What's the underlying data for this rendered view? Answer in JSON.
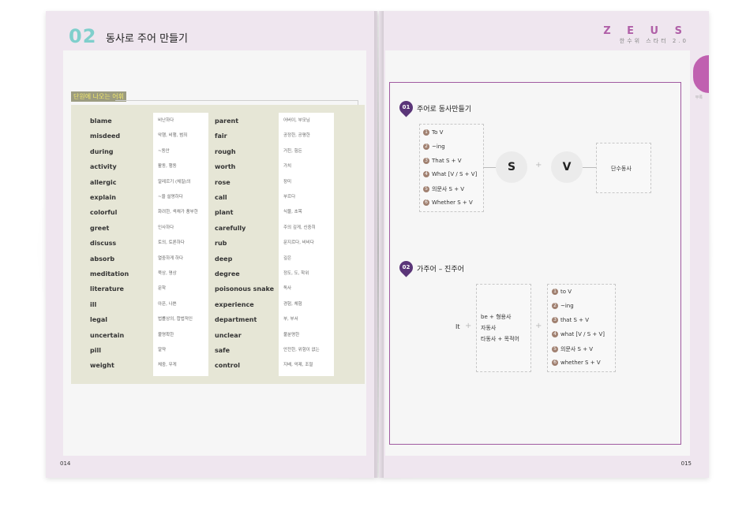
{
  "left_page": {
    "chapter_number": "02",
    "chapter_title": "동사로 주어 만들기",
    "page_number": "014",
    "vocab_heading": "단원에 나오는 어휘",
    "vocab_col1": [
      {
        "en": "blame",
        "ko": "비난하다"
      },
      {
        "en": "misdeed",
        "ko": "악행, 비행, 범죄"
      },
      {
        "en": "during",
        "ko": "~동안"
      },
      {
        "en": "activity",
        "ko": "활동, 행동"
      },
      {
        "en": "allergic",
        "ko": "알레르기 (체질)의"
      },
      {
        "en": "explain",
        "ko": "~을 설명하다"
      },
      {
        "en": "colorful",
        "ko": "화려한, 색채가 풍부한"
      },
      {
        "en": "greet",
        "ko": "인사하다"
      },
      {
        "en": "discuss",
        "ko": "토의, 토론하다"
      },
      {
        "en": "absorb",
        "ko": "열중하게 하다"
      },
      {
        "en": "meditation",
        "ko": "묵상, 명상"
      },
      {
        "en": "literature",
        "ko": "문학"
      },
      {
        "en": "ill",
        "ko": "아픈, 나쁜"
      },
      {
        "en": "legal",
        "ko": "법률상의, 합법적인"
      },
      {
        "en": "uncertain",
        "ko": "불명확한"
      },
      {
        "en": "pill",
        "ko": "알약"
      },
      {
        "en": "weight",
        "ko": "체중, 무게"
      }
    ],
    "vocab_col2": [
      {
        "en": "parent",
        "ko": "어버이, 부모님"
      },
      {
        "en": "fair",
        "ko": "공정한, 공평한"
      },
      {
        "en": "rough",
        "ko": "거친, 힘든"
      },
      {
        "en": "worth",
        "ko": "가치"
      },
      {
        "en": "rose",
        "ko": "장미"
      },
      {
        "en": "call",
        "ko": "부르다"
      },
      {
        "en": "plant",
        "ko": "식물, 초목"
      },
      {
        "en": "carefully",
        "ko": "주의 깊게, 신중히"
      },
      {
        "en": "rub",
        "ko": "문지르다, 비비다"
      },
      {
        "en": "deep",
        "ko": "깊은"
      },
      {
        "en": "degree",
        "ko": "정도, 도, 학위"
      },
      {
        "en": "poisonous snake",
        "ko": "독사"
      },
      {
        "en": "experience",
        "ko": "경험, 체험"
      },
      {
        "en": "department",
        "ko": "부, 부서"
      },
      {
        "en": "unclear",
        "ko": "불분명한"
      },
      {
        "en": "safe",
        "ko": "안전한, 위험이 없는"
      },
      {
        "en": "control",
        "ko": "지배, 억제, 조절"
      }
    ]
  },
  "right_page": {
    "brand": "Z E U S",
    "brand_sub": "한수위 스타터 2.0",
    "side_label": "부록",
    "page_number": "015",
    "section1": {
      "icon_number": "01",
      "title": "주어로 동사만들기",
      "items": [
        {
          "n": "1",
          "text": "To V"
        },
        {
          "n": "2",
          "text": "~ing"
        },
        {
          "n": "3",
          "text": "That S + V"
        },
        {
          "n": "4",
          "text": "What [V / S + V]"
        },
        {
          "n": "5",
          "text": "의문사 S + V"
        },
        {
          "n": "6",
          "text": "Whether S + V"
        }
      ],
      "circle_s": "S",
      "plus": "+",
      "circle_v": "V",
      "result": "단수동사"
    },
    "section2": {
      "icon_number": "02",
      "title": "가주어 – 진주어",
      "it": "It",
      "plus": "+",
      "middle": [
        "be + 형용사",
        "자동사",
        "타동사 + 목적어"
      ],
      "items": [
        {
          "n": "1",
          "text": "to V"
        },
        {
          "n": "2",
          "text": "~ing"
        },
        {
          "n": "3",
          "text": "that S + V"
        },
        {
          "n": "4",
          "text": "what [V / S + V]"
        },
        {
          "n": "5",
          "text": "의문사 S + V"
        },
        {
          "n": "6",
          "text": "whether S + V"
        }
      ]
    }
  }
}
